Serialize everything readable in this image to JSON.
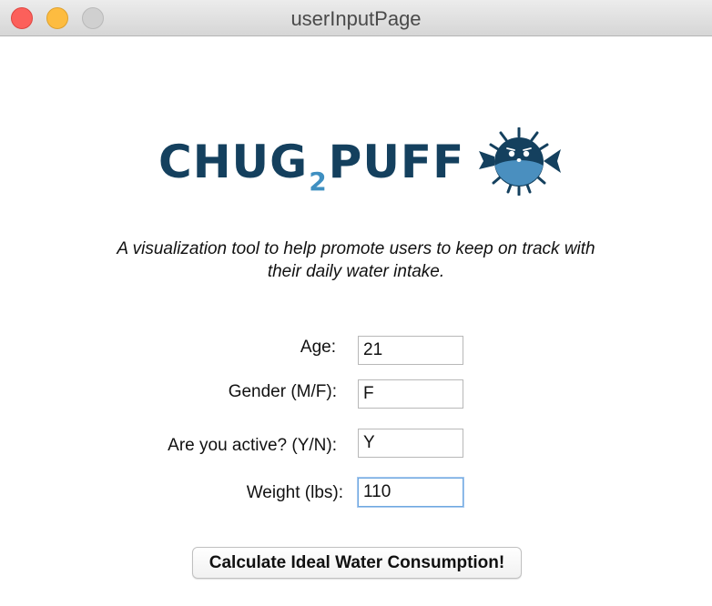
{
  "window": {
    "title": "userInputPage"
  },
  "logo": {
    "text_left": "CHUG",
    "text_sub": "2",
    "text_right": "PUFF",
    "icon": "pufferfish-icon",
    "colors": {
      "primary": "#14405e",
      "accent": "#3f8fc1"
    }
  },
  "tagline": {
    "line1": "A visualization tool to help promote users to keep on track with",
    "line2": "their daily water intake."
  },
  "form": {
    "age": {
      "label": "Age:",
      "value": "21"
    },
    "gender": {
      "label": "Gender (M/F):",
      "value": "F"
    },
    "active": {
      "label": "Are you active? (Y/N):",
      "value": "Y"
    },
    "weight": {
      "label": "Weight (lbs):",
      "value": "110"
    }
  },
  "button": {
    "label": "Calculate Ideal Water Consumption!"
  }
}
